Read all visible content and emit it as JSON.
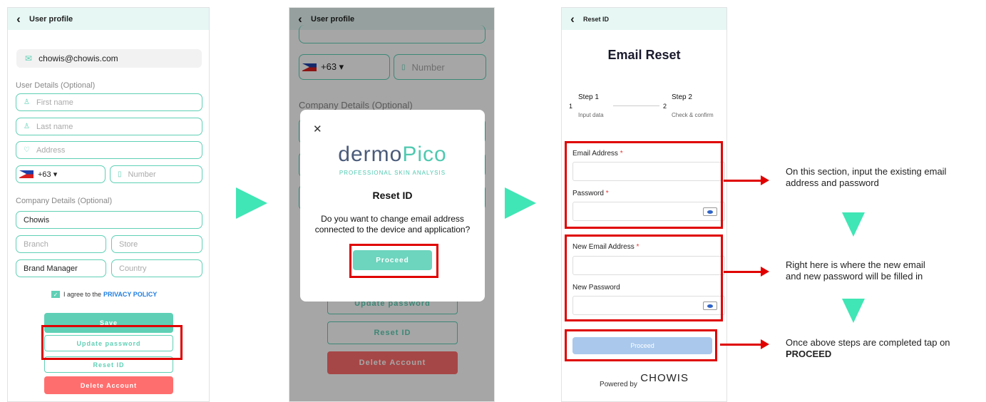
{
  "phone1": {
    "title": "User profile",
    "email": "chowis@chowis.com",
    "user_details_label": "User Details (Optional)",
    "first_name_placeholder": "First name",
    "last_name_placeholder": "Last name",
    "address_placeholder": "Address",
    "country_code": "+63 ▾",
    "number_placeholder": "Number",
    "company_details_label": "Company Details (Optional)",
    "company": "Chowis",
    "branch_placeholder": "Branch",
    "store_placeholder": "Store",
    "position": "Brand Manager",
    "country_placeholder": "Country",
    "agree_prefix": "I agree to the",
    "agree_link": "PRIVACY POLICY",
    "save_label": "Save",
    "update_password_label": "Update password",
    "reset_id_label": "Reset ID",
    "delete_label": "Delete Account"
  },
  "phone2": {
    "title": "User profile",
    "country_code": "+63 ▾",
    "number_placeholder": "Number",
    "company_details_label": "Company Details (Optional)",
    "update_password_label": "Update password",
    "reset_id_label": "Reset ID",
    "delete_label": "Delete Account",
    "modal": {
      "close": "✕",
      "brand_a": "dermo",
      "brand_b": "Pico",
      "tagline": "PROFESSIONAL SKIN ANALYSIS",
      "title": "Reset ID",
      "message": "Do you want to change email address connected to the device and application?",
      "proceed_label": "Proceed"
    }
  },
  "phone3": {
    "title": "Reset ID",
    "heading": "Email Reset",
    "step1_num": "1",
    "step1_title": "Step 1",
    "step1_sub": "Input data",
    "step2_num": "2",
    "step2_title": "Step 2",
    "step2_sub": "Check & confirm",
    "email_label": "Email Address",
    "password_label": "Password",
    "new_email_label": "New Email Address",
    "new_password_label": "New Password",
    "required_mark": "*",
    "proceed_label": "Proceed",
    "powered_by": "Powered by",
    "brand": "CHOWIS"
  },
  "annotations": {
    "note1": "On this section, input the existing email address and password",
    "note2": "Right here is where the new email and new password will be filled in",
    "note3_prefix": "Once above steps are completed tap on",
    "note3_bold": "PROCEED"
  },
  "colors": {
    "accent": "#5fd0b5",
    "arrow": "#40e6b5",
    "highlight": "#e00000",
    "danger": "#ff6e6e",
    "header_bg": "#e6f7f4",
    "disabled_button": "#a9c8ec"
  }
}
